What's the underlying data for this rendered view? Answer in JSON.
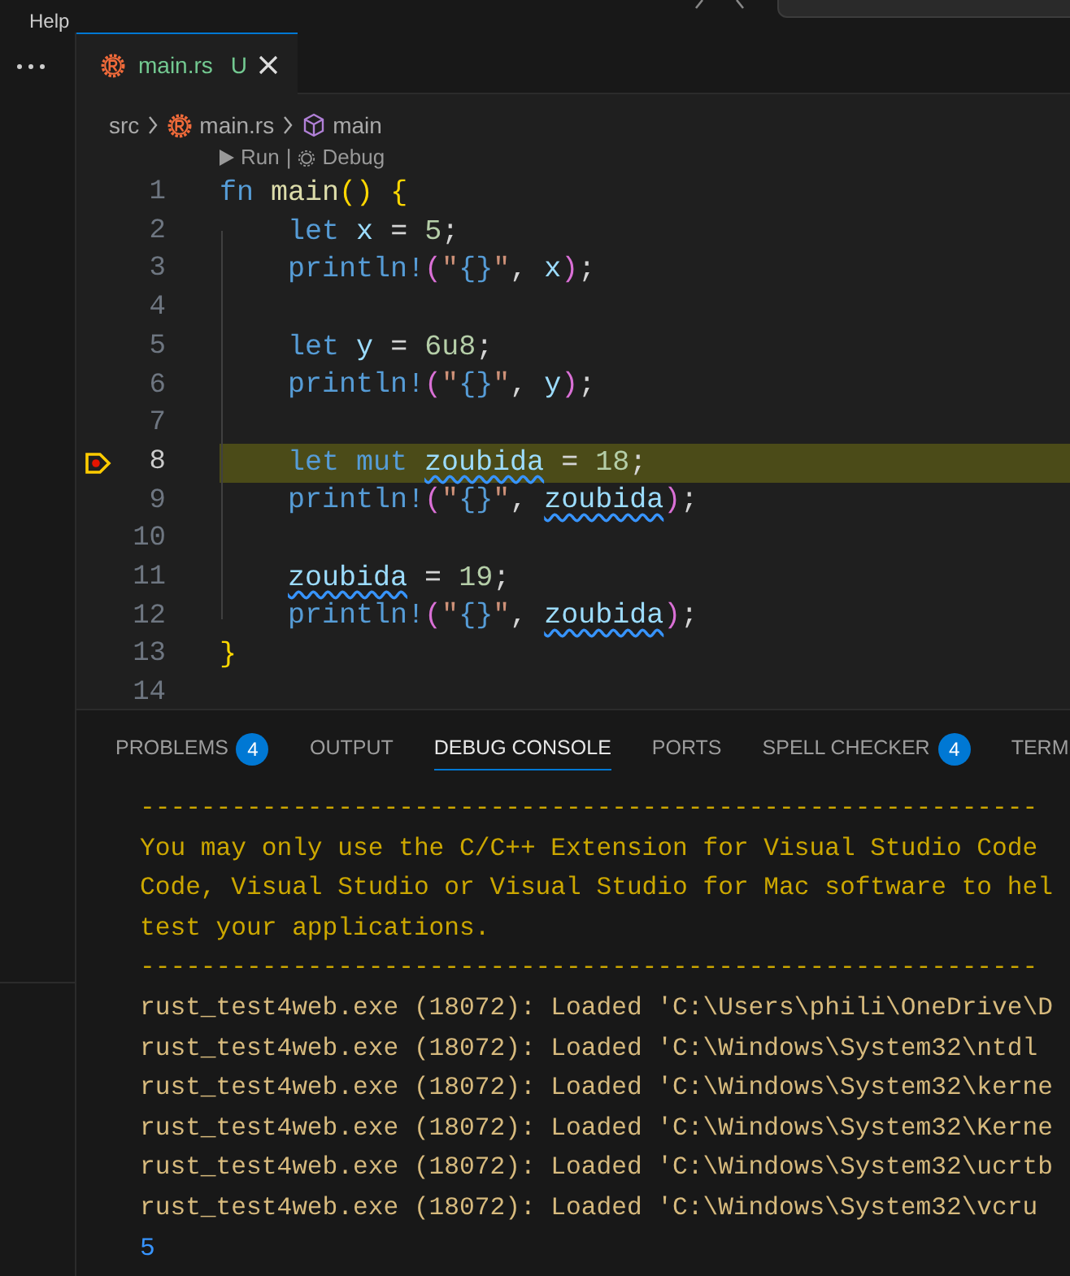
{
  "menu": {
    "items": [
      "Help"
    ]
  },
  "editor_tab": {
    "filename": "main.rs",
    "status": "U",
    "selected": true
  },
  "breadcrumbs": [
    "src",
    "main.rs",
    "main"
  ],
  "codelens": {
    "run": "Run",
    "separator": "|",
    "debug": "Debug"
  },
  "code_lines": [
    {
      "number": "1",
      "current": false,
      "breakpoint": false,
      "tokens": [
        {
          "text": "fn",
          "kind": "keyword"
        },
        {
          "text": " main",
          "kind": "function"
        },
        {
          "text": "()",
          "kind": "bracket"
        },
        {
          "text": " {",
          "kind": "bracket"
        }
      ]
    },
    {
      "number": "2",
      "current": false,
      "breakpoint": false,
      "tokens": [
        {
          "text": "    let",
          "kind": "keyword"
        },
        {
          "text": " x",
          "kind": "variable"
        },
        {
          "text": " =",
          "kind": "punct"
        },
        {
          "text": " 5",
          "kind": "number"
        },
        {
          "text": ";",
          "kind": "punct"
        }
      ]
    },
    {
      "number": "3",
      "current": false,
      "breakpoint": false,
      "tokens": [
        {
          "text": "    println!",
          "kind": "macro"
        },
        {
          "text": "(",
          "kind": "paren"
        },
        {
          "text": "\"",
          "kind": "string"
        },
        {
          "text": "{}",
          "kind": "format"
        },
        {
          "text": "\"",
          "kind": "string"
        },
        {
          "text": ",",
          "kind": "punct"
        },
        {
          "text": " x",
          "kind": "variable"
        },
        {
          "text": ")",
          "kind": "paren"
        },
        {
          "text": ";",
          "kind": "punct"
        }
      ]
    },
    {
      "number": "4",
      "current": false,
      "breakpoint": false
    },
    {
      "number": "5",
      "current": false,
      "breakpoint": false,
      "tokens": [
        {
          "text": "    let",
          "kind": "keyword"
        },
        {
          "text": " y",
          "kind": "variable"
        },
        {
          "text": " =",
          "kind": "punct"
        },
        {
          "text": " 6u8",
          "kind": "number"
        },
        {
          "text": ";",
          "kind": "punct"
        }
      ]
    },
    {
      "number": "6",
      "current": false,
      "breakpoint": false,
      "tokens": [
        {
          "text": "    println!",
          "kind": "macro"
        },
        {
          "text": "(",
          "kind": "paren"
        },
        {
          "text": "\"",
          "kind": "string"
        },
        {
          "text": "{}",
          "kind": "format"
        },
        {
          "text": "\"",
          "kind": "string"
        },
        {
          "text": ",",
          "kind": "punct"
        },
        {
          "text": " y",
          "kind": "variable"
        },
        {
          "text": ")",
          "kind": "paren"
        },
        {
          "text": ";",
          "kind": "punct"
        }
      ]
    },
    {
      "number": "7",
      "current": false,
      "breakpoint": false
    },
    {
      "number": "8",
      "current": true,
      "breakpoint": true,
      "tokens": [
        {
          "text": "    let mut",
          "kind": "keyword"
        },
        {
          "text": " zoubida",
          "kind": "variable",
          "warning": true
        },
        {
          "text": " =",
          "kind": "punct"
        },
        {
          "text": " 18",
          "kind": "number"
        },
        {
          "text": ";",
          "kind": "punct"
        }
      ]
    },
    {
      "number": "9",
      "current": false,
      "breakpoint": false,
      "tokens": [
        {
          "text": "    println!",
          "kind": "macro"
        },
        {
          "text": "(",
          "kind": "paren"
        },
        {
          "text": "\"",
          "kind": "string"
        },
        {
          "text": "{}",
          "kind": "format"
        },
        {
          "text": "\"",
          "kind": "string"
        },
        {
          "text": ", ",
          "kind": "punct"
        },
        {
          "text": "zoubida",
          "kind": "variable",
          "warning": true
        },
        {
          "text": ")",
          "kind": "paren"
        },
        {
          "text": ";",
          "kind": "punct"
        }
      ]
    },
    {
      "number": "10",
      "current": false,
      "breakpoint": false
    },
    {
      "number": "11",
      "current": false,
      "breakpoint": false,
      "tokens": [
        {
          "text": "    zoubida",
          "kind": "variable",
          "warning": true
        },
        {
          "text": " =",
          "kind": "punct"
        },
        {
          "text": " 19",
          "kind": "number"
        },
        {
          "text": ";",
          "kind": "punct"
        }
      ]
    },
    {
      "number": "12",
      "current": false,
      "breakpoint": false,
      "tokens": [
        {
          "text": "    println!",
          "kind": "macro"
        },
        {
          "text": "(",
          "kind": "paren"
        },
        {
          "text": "\"",
          "kind": "string"
        },
        {
          "text": "{}",
          "kind": "format"
        },
        {
          "text": "\"",
          "kind": "string"
        },
        {
          "text": ", ",
          "kind": "punct"
        },
        {
          "text": "zoubida",
          "kind": "variable",
          "warning": true
        },
        {
          "text": ")",
          "kind": "paren"
        },
        {
          "text": ";",
          "kind": "punct"
        }
      ]
    },
    {
      "number": "13",
      "current": false,
      "breakpoint": false,
      "tokens": [
        {
          "text": "}",
          "kind": "bracket"
        }
      ]
    },
    {
      "number": "14",
      "current": false,
      "breakpoint": false
    }
  ],
  "panel_tabs": [
    {
      "label": "PROBLEMS",
      "badge": "4",
      "selected": false
    },
    {
      "label": "OUTPUT",
      "selected": false
    },
    {
      "label": "DEBUG CONSOLE",
      "selected": true
    },
    {
      "label": "PORTS",
      "selected": false
    },
    {
      "label": "SPELL CHECKER",
      "badge": "4",
      "selected": false
    },
    {
      "label": "TERM",
      "selected": false
    }
  ],
  "console_lines": [
    {
      "kind": "warning",
      "text": "-----------------------------------------------------------"
    },
    {
      "kind": "warning",
      "text": "You may only use the C/C++ Extension for Visual Studio Code"
    },
    {
      "kind": "warning",
      "text": "Code, Visual Studio or Visual Studio for Mac software to hel"
    },
    {
      "kind": "warning",
      "text": "test your applications."
    },
    {
      "kind": "warning",
      "text": "-----------------------------------------------------------"
    },
    {
      "kind": "log",
      "text": "rust_test4web.exe (18072): Loaded 'C:\\Users\\phili\\OneDrive\\D"
    },
    {
      "kind": "log",
      "text": "rust_test4web.exe (18072): Loaded 'C:\\Windows\\System32\\ntdl"
    },
    {
      "kind": "log",
      "text": "rust_test4web.exe (18072): Loaded 'C:\\Windows\\System32\\kerne"
    },
    {
      "kind": "log",
      "text": "rust_test4web.exe (18072): Loaded 'C:\\Windows\\System32\\Kerne"
    },
    {
      "kind": "log",
      "text": "rust_test4web.exe (18072): Loaded 'C:\\Windows\\System32\\ucrtb"
    },
    {
      "kind": "log",
      "text": "rust_test4web.exe (18072): Loaded 'C:\\Windows\\System32\\vcru"
    },
    {
      "kind": "output",
      "text": "5"
    }
  ]
}
